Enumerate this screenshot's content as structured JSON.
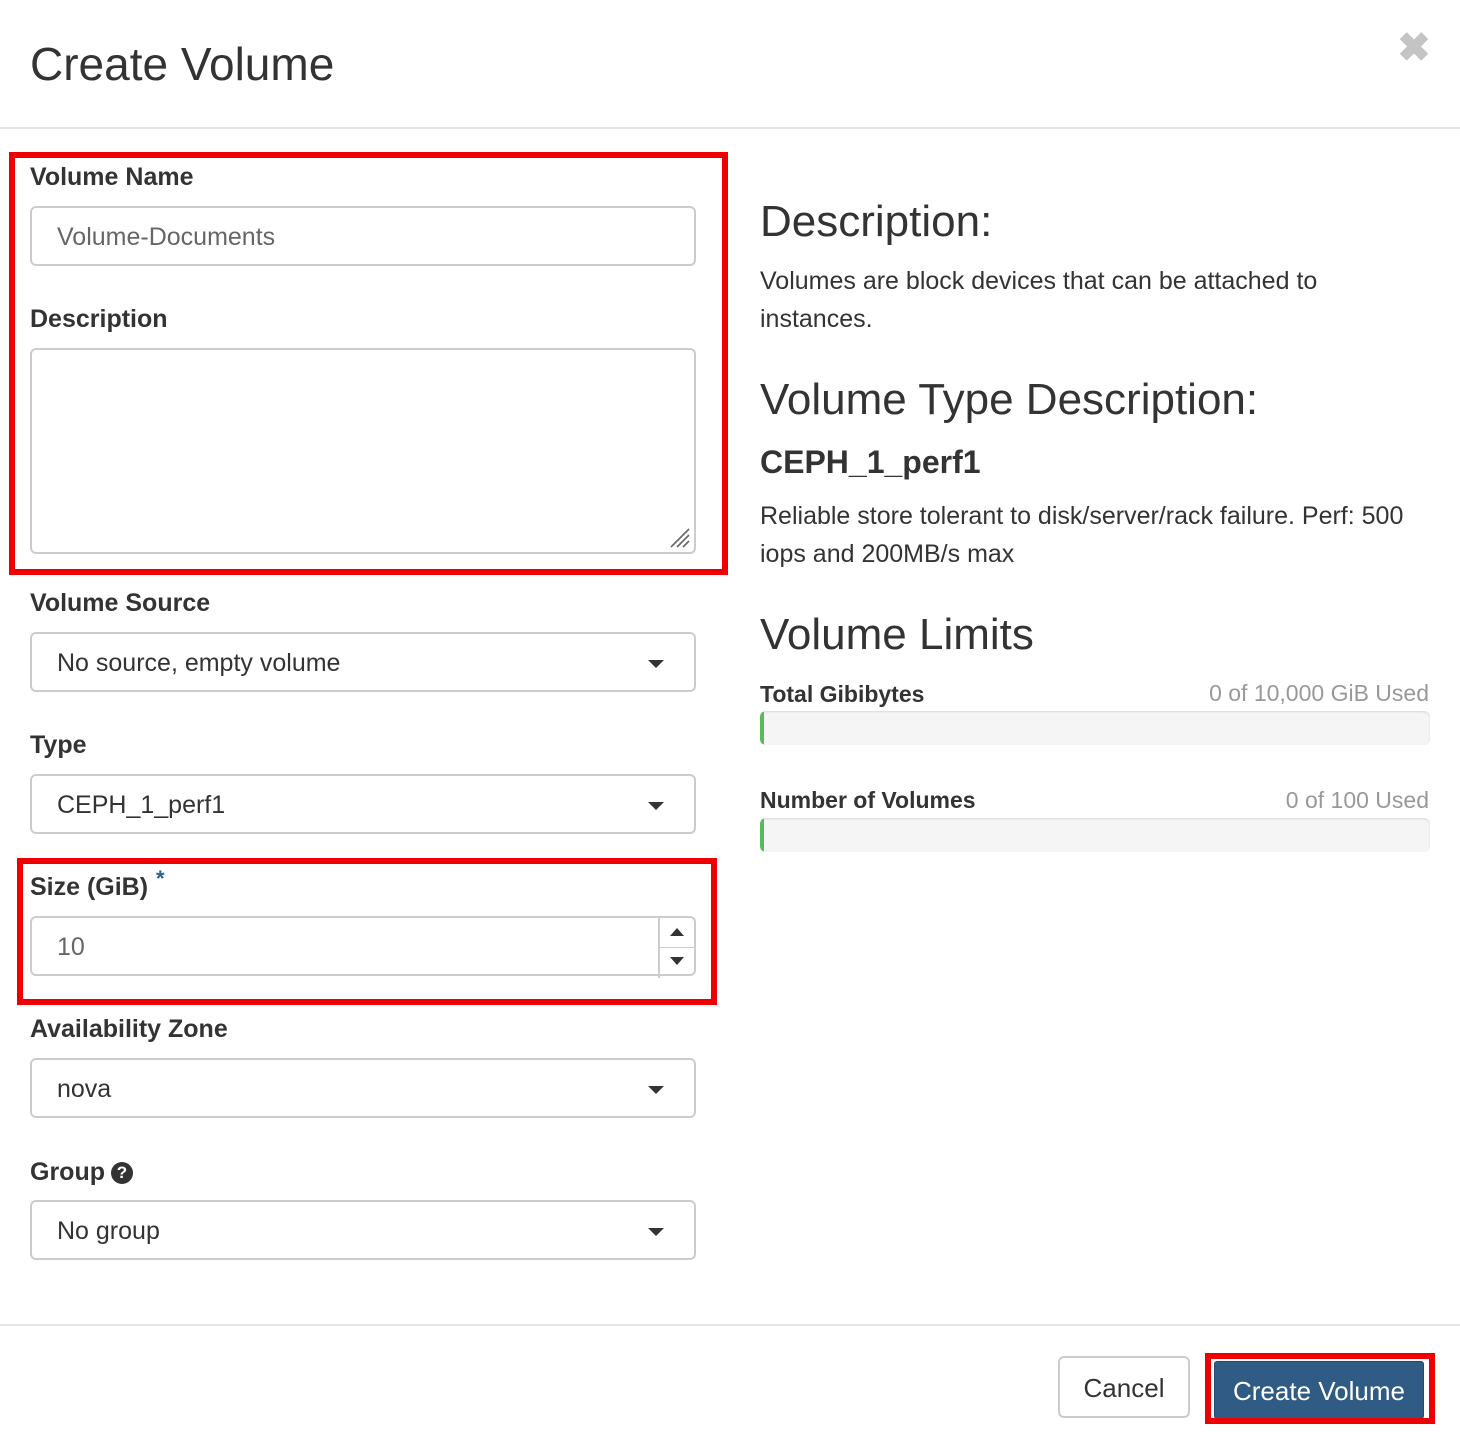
{
  "modal": {
    "title": "Create Volume",
    "close_icon": "close-icon",
    "close_glyph": "✖"
  },
  "form": {
    "volume_name": {
      "label": "Volume Name",
      "placeholder": "Volume-Documents",
      "value": ""
    },
    "description": {
      "label": "Description",
      "value": ""
    },
    "volume_source": {
      "label": "Volume Source",
      "selected": "No source, empty volume"
    },
    "type": {
      "label": "Type",
      "selected": "CEPH_1_perf1"
    },
    "size": {
      "label": "Size (GiB)",
      "required_mark": "*",
      "value": "10"
    },
    "availability_zone": {
      "label": "Availability Zone",
      "selected": "nova"
    },
    "group": {
      "label": "Group",
      "help_icon": "question-circle-icon",
      "help_glyph": "?",
      "selected": "No group"
    }
  },
  "info": {
    "description_heading": "Description:",
    "description_text": "Volumes are block devices that can be attached to instances.",
    "type_heading": "Volume Type Description:",
    "type_name": "CEPH_1_perf1",
    "type_text": "Reliable store tolerant to disk/server/rack failure. Perf: 500 iops and 200MB/s max",
    "limits_heading": "Volume Limits",
    "limits": [
      {
        "label": "Total Gibibytes",
        "used_text": "0 of 10,000 GiB Used",
        "fraction": 0.0
      },
      {
        "label": "Number of Volumes",
        "used_text": "0 of 100 Used",
        "fraction": 0.0
      }
    ]
  },
  "footer": {
    "cancel_label": "Cancel",
    "submit_label": "Create Volume"
  },
  "colors": {
    "primary_button": "#2f5b84",
    "progress_fill": "#5cb85c",
    "highlight_box": "#ee0000",
    "required_star": "#2c5e89"
  }
}
